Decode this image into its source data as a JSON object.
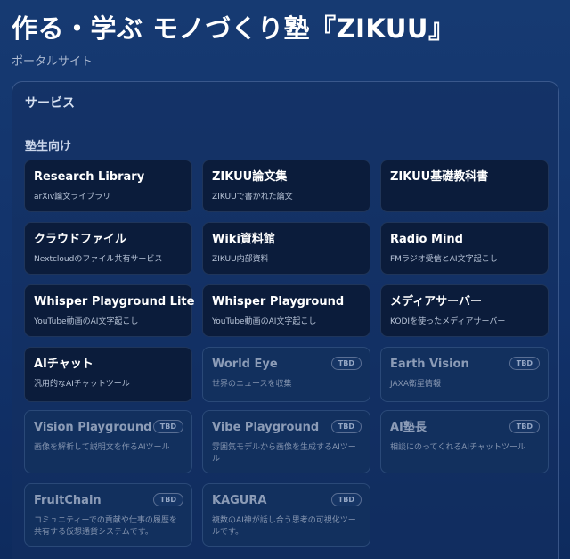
{
  "header": {
    "title": "作る・学ぶ モノづくり塾『ZIKUU』",
    "subtitle": "ポータルサイト"
  },
  "services": {
    "section_title": "サービス",
    "group_title": "塾生向け",
    "cards": [
      {
        "name": "Research Library",
        "desc": "arXiv論文ライブラリ",
        "status": ""
      },
      {
        "name": "ZIKUU論文集",
        "desc": "ZIKUUで書かれた論文",
        "status": ""
      },
      {
        "name": "ZIKUU基礎教科書",
        "desc": "",
        "status": ""
      },
      {
        "name": "クラウドファイル",
        "desc": "Nextcloudのファイル共有サービス",
        "status": ""
      },
      {
        "name": "Wiki資料館",
        "desc": "ZIKUU内部資料",
        "status": ""
      },
      {
        "name": "Radio Mind",
        "desc": "FMラジオ受信とAI文字起こし",
        "status": ""
      },
      {
        "name": "Whisper Playground Lite",
        "desc": "YouTube動画のAI文字起こし",
        "status": ""
      },
      {
        "name": "Whisper Playground",
        "desc": "YouTube動画のAI文字起こし",
        "status": ""
      },
      {
        "name": "メディアサーバー",
        "desc": "KODIを使ったメディアサーバー",
        "status": ""
      },
      {
        "name": "AIチャット",
        "desc": "汎用的なAIチャットツール",
        "status": ""
      },
      {
        "name": "World Eye",
        "desc": "世界のニュースを収集",
        "status": "TBD"
      },
      {
        "name": "Earth Vision",
        "desc": "JAXA衛星情報",
        "status": "TBD"
      },
      {
        "name": "Vision Playground",
        "desc": "画像を解析して説明文を作るAIツール",
        "status": "TBD"
      },
      {
        "name": "Vibe Playground",
        "desc": "雰囲気モデルから画像を生成するAIツール",
        "status": "TBD"
      },
      {
        "name": "AI塾長",
        "desc": "相談にのってくれるAIチャットツール",
        "status": "TBD"
      },
      {
        "name": "FruitChain",
        "desc": "コミュニティーでの貢献や仕事の履歴を共有する仮想通貨システムです。",
        "status": "TBD"
      },
      {
        "name": "KAGURA",
        "desc": "複数のAI神が話し合う思考の可視化ツールです。",
        "status": "TBD"
      }
    ]
  }
}
